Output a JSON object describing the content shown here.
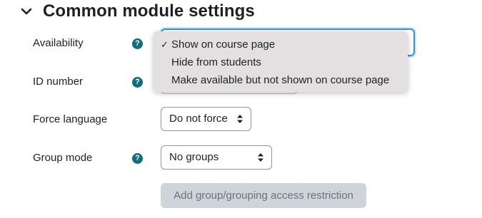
{
  "section": {
    "title": "Common module settings",
    "expanded": true
  },
  "fields": {
    "availability": {
      "label": "Availability",
      "selected": "Show on course page",
      "options": [
        "Show on course page",
        "Hide from students",
        "Make available but not shown on course page"
      ]
    },
    "id_number": {
      "label": "ID number",
      "value": ""
    },
    "force_language": {
      "label": "Force language",
      "value": "Do not force"
    },
    "group_mode": {
      "label": "Group mode",
      "value": "No groups"
    }
  },
  "help_icon_glyph": "?",
  "check_glyph": "✓",
  "restriction_button": {
    "label": "Add group/grouping access restriction",
    "enabled": false
  },
  "colors": {
    "help_icon": "#0f6e79",
    "focus_ring": "#3d8fd9",
    "dropdown_bg": "#e4dfe1",
    "disabled_button_bg": "#ced4da"
  },
  "icons": {
    "section_toggle": "chevron-down-icon",
    "select_arrows": "sort-arrows-icon",
    "help": "help-circle-icon",
    "selected_option": "checkmark-icon"
  }
}
